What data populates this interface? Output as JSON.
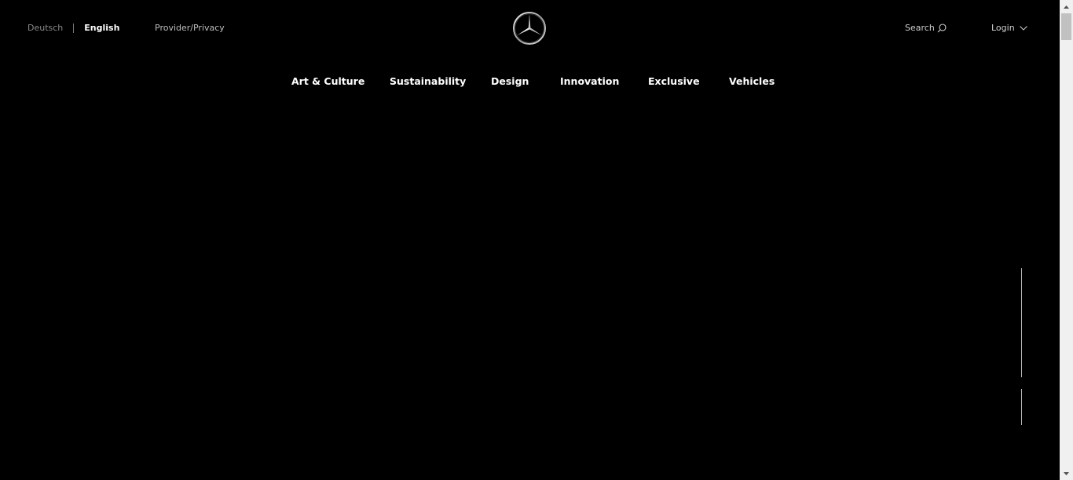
{
  "header": {
    "languages": [
      {
        "label": "Deutsch",
        "active": false
      },
      {
        "label": "English",
        "active": true
      }
    ],
    "provider_link": "Provider/Privacy",
    "logo": {
      "icon": "mercedes-star-icon"
    },
    "search_label": "Search",
    "login_label": "Login"
  },
  "nav": {
    "items": [
      {
        "label": "Art & Culture"
      },
      {
        "label": "Sustainability"
      },
      {
        "label": "Design"
      },
      {
        "label": "Innovation"
      },
      {
        "label": "Exclusive"
      },
      {
        "label": "Vehicles"
      }
    ]
  },
  "colors": {
    "background": "#000000",
    "text_primary": "#ffffff",
    "text_muted": "#8a8a8a",
    "scrollbar_track": "#f0f0f0",
    "scrollbar_thumb": "#c1c1c1"
  }
}
